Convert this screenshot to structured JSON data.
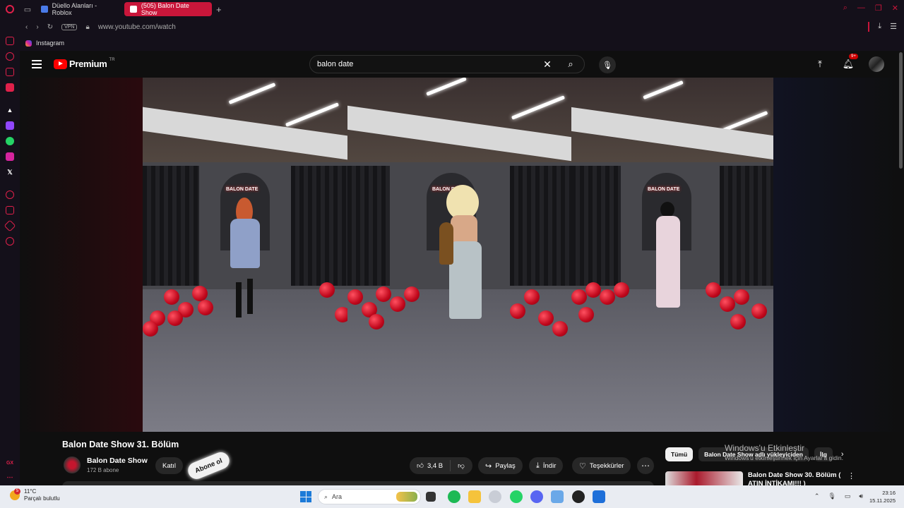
{
  "browser": {
    "tabs": [
      {
        "label": "Düello Alanları - Roblox",
        "active": false
      },
      {
        "label": "(505) Balon Date Show",
        "active": true
      }
    ],
    "url": "www.youtube.com/watch",
    "vpn_label": "VPN",
    "bookmark": "Instagram"
  },
  "youtube": {
    "brand": "Premium",
    "region": "TR",
    "search_value": "balon date",
    "notifications_badge": "9+",
    "video": {
      "title": "Balon Date Show 31. Bölüm",
      "neon_sign": "BALON DATE"
    },
    "channel": {
      "name": "Balon Date Show",
      "subscribers": "172 B abone",
      "join_label": "Katıl",
      "subscribe_label": "Abone ol"
    },
    "actions": {
      "likes": "3,4 B",
      "share": "Paylaş",
      "download": "İndir",
      "thanks": "Teşekkürler"
    },
    "chips": [
      {
        "label": "Tümü",
        "active": true
      },
      {
        "label": "Balon Date Show adlı yükleyiciden",
        "active": false
      },
      {
        "label": "İlg",
        "active": false
      }
    ],
    "recommendation": {
      "title": "Balon Date Show 30. Bölüm ( ATIN İNTİKAMI!!! )"
    }
  },
  "windows_activation": {
    "line1": "Windows'u Etkinleştir",
    "line2": "Windows'u etkinleştirmek için Ayarlar'a gidin."
  },
  "taskbar": {
    "weather_temp": "11°C",
    "weather_desc": "Parçalı bulutlu",
    "weather_badge": "5",
    "search_placeholder": "Ara",
    "time": "23:16",
    "date": "15.11.2025"
  },
  "colors": {
    "accent": "#c9163a",
    "yt_red": "#ff0000",
    "background": "#0f0f0f"
  }
}
